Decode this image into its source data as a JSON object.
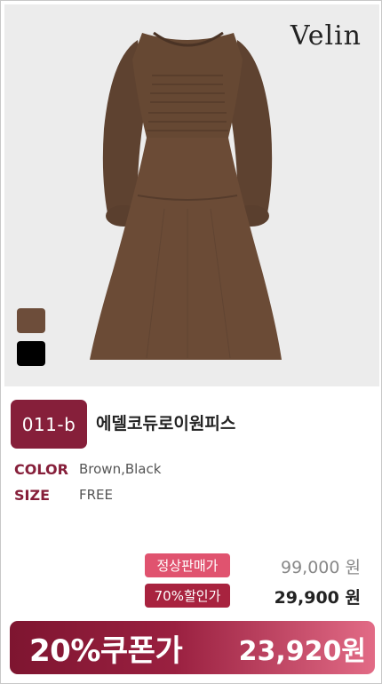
{
  "product": {
    "brand_logo": "Velin",
    "image_alt": "Brown corduroy smocked long-sleeve dress",
    "swatches": [
      {
        "name": "brown-swatch",
        "color": "#6d4d3a"
      },
      {
        "name": "black-swatch",
        "color": "#000000"
      }
    ],
    "code": "011-b",
    "title": "에델코듀로이원피스",
    "specs": {
      "color_label": "COLOR",
      "color_value": "Brown,Black",
      "size_label": "SIZE",
      "size_value": "FREE"
    }
  },
  "pricing": {
    "regular_label": "정상판매가",
    "regular_price": "99,000 원",
    "discount_label": "70%할인가",
    "discount_price": "29,900 원",
    "coupon_label": "20%쿠폰가",
    "coupon_price": "23,920원"
  },
  "colors": {
    "accent": "#861f3a",
    "tag_pink": "#e0536f",
    "tag_red": "#a8233f"
  }
}
